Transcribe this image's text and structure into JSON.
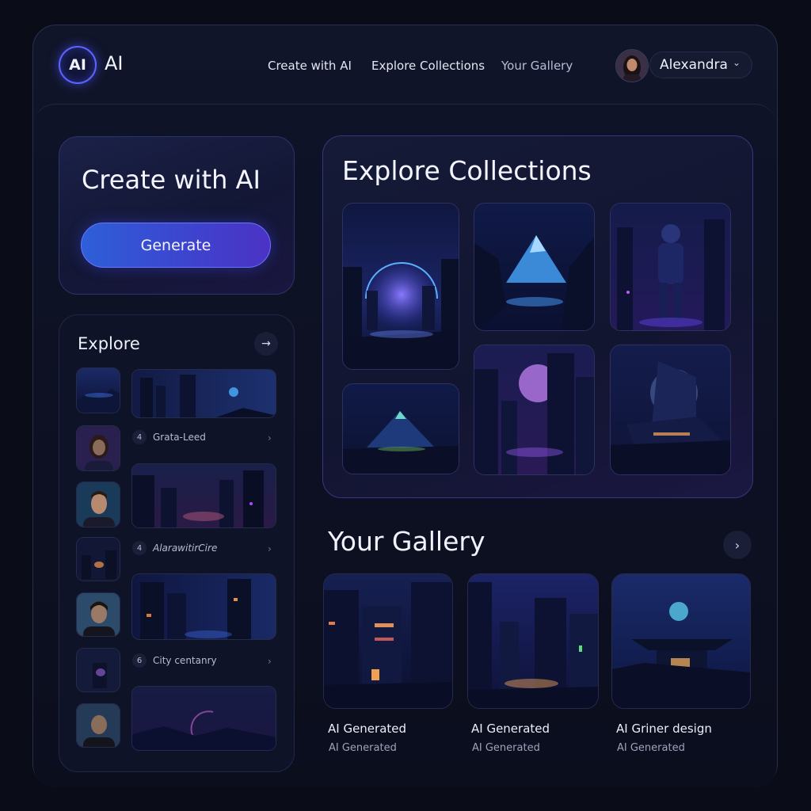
{
  "header": {
    "logo_text": "AI",
    "brand": "AI",
    "nav": [
      "Create with AI",
      "Explore Collections",
      "Your Gallery"
    ],
    "user_name": "Alexandra",
    "user_icon": "chevron-down-icon"
  },
  "create": {
    "title": "Create with AI",
    "button_label": "Generate"
  },
  "explore": {
    "title": "Explore",
    "arrow": "→",
    "rows": [
      {
        "num": "4",
        "label": "Grata-Leed"
      },
      {
        "num": "4",
        "label": "AlarawitirCire"
      },
      {
        "num": "6",
        "label": "City centanry"
      }
    ]
  },
  "collections": {
    "title": "Explore Collections"
  },
  "gallery": {
    "title": "Your Gallery",
    "items": [
      {
        "name": "AI Generated",
        "sub": "AI Generated"
      },
      {
        "name": "AI Generated",
        "sub": "AI Generated"
      },
      {
        "name": "AI Griner design",
        "sub": "AI Generated"
      }
    ]
  },
  "colors": {
    "background": "#0a0c17",
    "accent": "#4b55ff",
    "button_gradient_start": "#2e5fd8",
    "button_gradient_end": "#4b32c4"
  }
}
